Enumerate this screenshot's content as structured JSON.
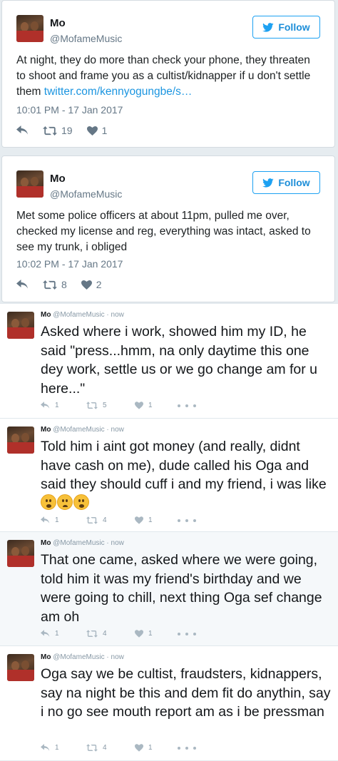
{
  "embedded_tweets": [
    {
      "name": "Mo",
      "handle": "@MofameMusic",
      "follow_label": "Follow",
      "text": "At night, they do more than check your phone, they threaten to shoot and frame you as a cultist/kidnapper if u don't settle them ",
      "link": "twitter.com/kennyogungbe/s…",
      "timestamp": "10:01 PM - 17 Jan 2017",
      "retweets": "19",
      "likes": "1"
    },
    {
      "name": "Mo",
      "handle": "@MofameMusic",
      "follow_label": "Follow",
      "text": "Met some police officers at about 11pm, pulled me over, checked my license and reg, everything was intact, asked to see my trunk, i obliged",
      "timestamp": "10:02 PM - 17 Jan 2017",
      "retweets": "8",
      "likes": "2"
    }
  ],
  "timeline": [
    {
      "name": "Mo",
      "handle": "@MofameMusic",
      "time": "now",
      "text": "Asked where i work, showed him my ID, he said \"press...hmm, na only daytime this one dey work, settle us or we go change am for u here...\"",
      "replies": "1",
      "retweets": "5",
      "likes": "1"
    },
    {
      "name": "Mo",
      "handle": "@MofameMusic",
      "time": "now",
      "text": "Told him i aint got money (and really, didnt have cash on me), dude called his Oga and said they should cuff i and my friend, i was like ",
      "emojis": [
        "worried-face-emoji",
        "open-mouth-face-emoji",
        "astonished-face-emoji"
      ],
      "replies": "1",
      "retweets": "4",
      "likes": "1"
    },
    {
      "name": "Mo",
      "handle": "@MofameMusic",
      "time": "now",
      "text": "That one came, asked where we were going, told him it was my friend's birthday and we were going to chill, next thing Oga sef change am oh",
      "replies": "1",
      "retweets": "4",
      "likes": "1"
    },
    {
      "name": "Mo",
      "handle": "@MofameMusic",
      "time": "now",
      "text": "Oga say we be cultist, fraudsters, kidnappers, say na night be this and dem fit do anythin, say i no go see mouth report am as i be pressman",
      "replies": "1",
      "retweets": "4",
      "likes": "1"
    }
  ],
  "colors": {
    "twitter_blue": "#1da1f2",
    "link_blue": "#1b95e0",
    "muted_gray": "#657786",
    "background": "#e6ecf0"
  },
  "icons": [
    "twitter-bird-icon",
    "reply-icon",
    "retweet-icon",
    "heart-icon",
    "more-dots-icon"
  ]
}
